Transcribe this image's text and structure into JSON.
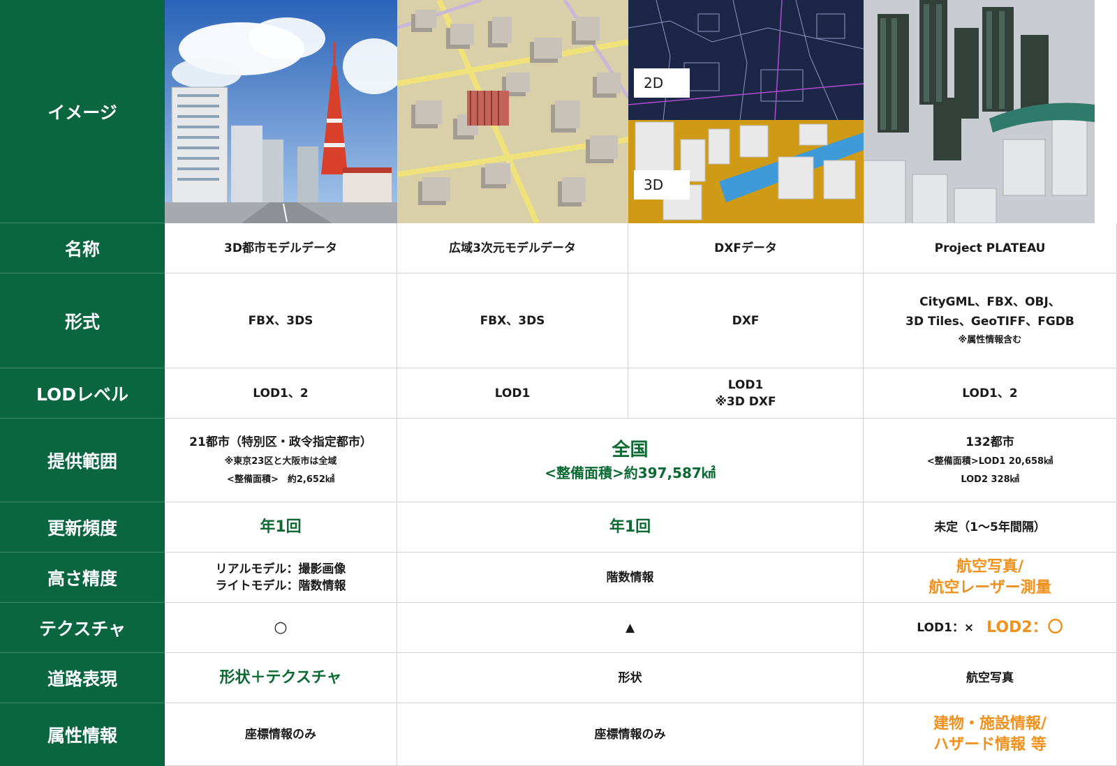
{
  "headers": {
    "image": "イメージ",
    "name": "名称",
    "format": "形式",
    "lod": "LODレベル",
    "coverage": "提供範囲",
    "update": "更新頻度",
    "height": "高さ精度",
    "texture": "テクスチャ",
    "road": "道路表現",
    "attributes": "属性情報"
  },
  "image_badges": {
    "two_d": "2D",
    "three_d": "3D"
  },
  "name": {
    "col1": "3D都市モデルデータ",
    "col2": "広域3次元モデルデータ",
    "col3": "DXFデータ",
    "col4": "Project PLATEAU"
  },
  "format": {
    "col1": "FBX、3DS",
    "col2": "FBX、3DS",
    "col3": "DXF",
    "col4_line1": "CityGML、FBX、OBJ、",
    "col4_line2": "3D Tiles、GeoTIFF、FGDB",
    "col4_note": "※属性情報含む"
  },
  "lod": {
    "col1": "LOD1、2",
    "col2": "LOD1",
    "col3_line1": "LOD1",
    "col3_line2": "※3D DXF",
    "col4": "LOD1、2"
  },
  "coverage": {
    "col1_line1": "21都市（特別区・政令指定都市）",
    "col1_line2": "※東京23区と大阪市は全域",
    "col1_line3": "<整備面積>　約2,652㎢",
    "col23_line1": "全国",
    "col23_line2": "<整備面積>約397,587㎢",
    "col4_line1": "132都市",
    "col4_line2": "<整備面積>LOD1 20,658㎢",
    "col4_line3": "LOD2 328㎢"
  },
  "update": {
    "col1": "年1回",
    "col23": "年1回",
    "col4": "未定（1〜5年間隔）"
  },
  "height": {
    "col1_line1": "リアルモデル：撮影画像",
    "col1_line2": "ライトモデル：階数情報",
    "col23": "階数情報",
    "col4_line1": "航空写真/",
    "col4_line2": "航空レーザー測量"
  },
  "texture": {
    "col1": "○",
    "col23": "▲",
    "col4_a": "LOD1：×",
    "col4_b": "LOD2：〇"
  },
  "road": {
    "col1": "形状＋テクスチャ",
    "col23": "形状",
    "col4": "航空写真"
  },
  "attributes": {
    "col1": "座標情報のみ",
    "col23": "座標情報のみ",
    "col4_line1": "建物・施設情報/",
    "col4_line2": "ハザード情報 等"
  },
  "colors": {
    "header_bg": "#0a6640",
    "accent_green": "#0a6a32",
    "accent_orange": "#f0901d",
    "grid": "#d3d3d3"
  }
}
